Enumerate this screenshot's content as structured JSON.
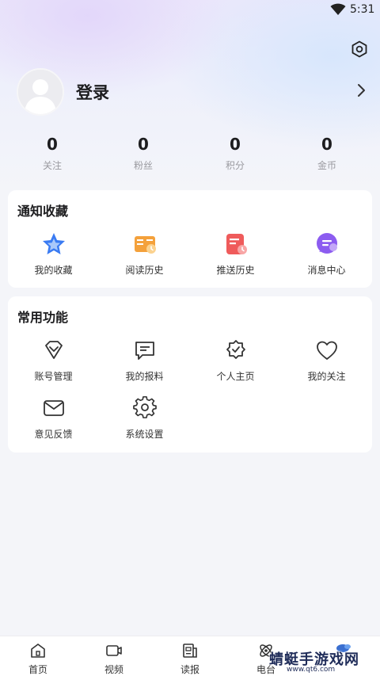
{
  "status_bar": {
    "time": "5:31"
  },
  "profile": {
    "login_label": "登录"
  },
  "stats": [
    {
      "value": "0",
      "label": "关注"
    },
    {
      "value": "0",
      "label": "粉丝"
    },
    {
      "value": "0",
      "label": "积分"
    },
    {
      "value": "0",
      "label": "金币"
    }
  ],
  "notify_section": {
    "title": "通知收藏",
    "items": [
      {
        "label": "我的收藏",
        "icon": "star-icon"
      },
      {
        "label": "阅读历史",
        "icon": "book-icon"
      },
      {
        "label": "推送历史",
        "icon": "push-history-icon"
      },
      {
        "label": "消息中心",
        "icon": "message-icon"
      }
    ]
  },
  "common_section": {
    "title": "常用功能",
    "items": [
      {
        "label": "账号管理",
        "icon": "diamond-icon"
      },
      {
        "label": "我的报料",
        "icon": "chat-icon"
      },
      {
        "label": "个人主页",
        "icon": "badge-check-icon"
      },
      {
        "label": "我的关注",
        "icon": "heart-icon"
      },
      {
        "label": "意见反馈",
        "icon": "mail-icon"
      },
      {
        "label": "系统设置",
        "icon": "gear-icon"
      }
    ]
  },
  "tabbar": [
    {
      "label": "首页",
      "icon": "home-icon"
    },
    {
      "label": "视频",
      "icon": "video-icon"
    },
    {
      "label": "读报",
      "icon": "newspaper-icon"
    },
    {
      "label": "电台",
      "icon": "radio-icon"
    }
  ],
  "watermark": {
    "text": "蜻蜓手游戏网",
    "url": "www.qt6.com"
  },
  "colors": {
    "accent_blue": "#3a7bf2",
    "accent_orange": "#f4a13b",
    "accent_red": "#ef5b5b",
    "accent_purple": "#8c5cf0",
    "icon_dark": "#333333"
  }
}
